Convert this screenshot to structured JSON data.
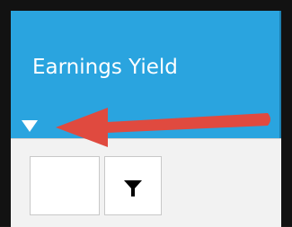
{
  "column": {
    "title": "Earnings Yield",
    "sort_icon": "triangle-down-icon"
  },
  "filter": {
    "input_value": "",
    "button_icon": "funnel-filter-icon"
  },
  "annotation": {
    "arrow_icon": "red-arrow-icon",
    "arrow_color": "#e04a3f"
  },
  "colors": {
    "header_bg": "#2aa4df",
    "header_text": "#ffffff",
    "frame": "#121212"
  }
}
